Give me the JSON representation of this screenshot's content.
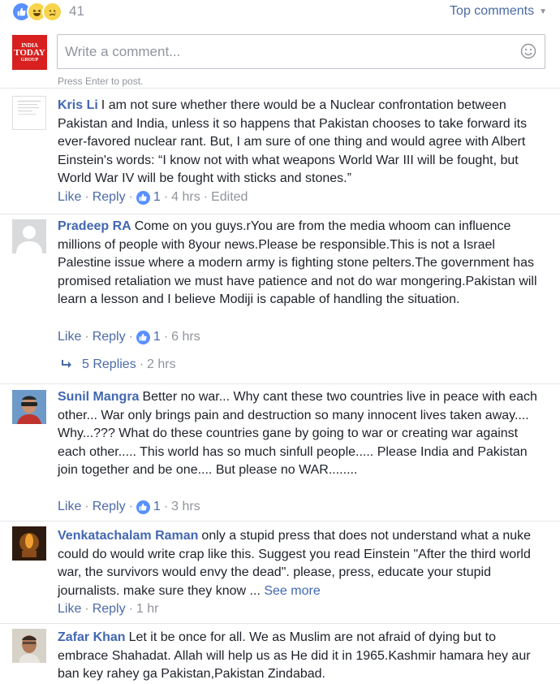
{
  "header": {
    "reaction_count": "41",
    "sort_label": "Top comments",
    "reaction_icons": [
      "like-icon",
      "haha-icon",
      "sad-icon"
    ]
  },
  "composer": {
    "logo_lines": [
      "INDIA",
      "TODAY",
      "GROUP"
    ],
    "placeholder": "Write a comment...",
    "hint": "Press Enter to post."
  },
  "actions": {
    "like": "Like",
    "reply": "Reply",
    "edited": "Edited",
    "dot": "·"
  },
  "comments": [
    {
      "author": "Kris Li",
      "text": "I am not sure whether there would be a Nuclear confrontation between Pakistan and India, unless it so happens that Pakistan chooses to take forward its ever-favored nuclear rant. But, I am sure of one thing and would agree with Albert Einstein's words: “I know not with what weapons World War III will be fought, but World War IV will be fought with sticks and stones.”",
      "likes": "1",
      "time": "4 hrs"
    },
    {
      "author": "Pradeep RA",
      "text": "Come on you guys.rYou are from the media whoom can influence millions of people with 8your news.Please be responsible.This is not a Israel Palestine issue where a modern army is fighting stone pelters.The government has promised retaliation we must have patience and not do war mongering.Pakistan will learn a lesson and I believe Modiji is capable of handling the situation.",
      "likes": "1",
      "time": "6 hrs",
      "replies": {
        "label": "5 Replies",
        "time": "2 hrs"
      }
    },
    {
      "author": "Sunil Mangra",
      "text": "Better no war... Why cant these two countries live in peace with each other... War only brings pain and destruction so many innocent lives taken away.... Why...??? What do these countries gane by going to war or creating war against each other..... This world has so much sinfull people..... Please India and Pakistan join together and be one.... But please no WAR........",
      "likes": "1",
      "time": "3 hrs"
    },
    {
      "author": "Venkatachalam Raman",
      "text": "only a stupid press that does not understand what a nuke could do would write crap like this. Suggest you read Einstein \"After the third world war, the survivors would envy the dead\". please, press, educate your stupid journalists. make sure they know ...",
      "see_more": "See more",
      "time": "1 hr"
    },
    {
      "author": "Zafar Khan",
      "text": "Let it be once for all. We as Muslim are not afraid of dying but to embrace Shahadat. Allah will help us as He did it in 1965.Kashmir hamara hey aur ban key rahey ga Pakistan,Pakistan Zindabad."
    }
  ]
}
